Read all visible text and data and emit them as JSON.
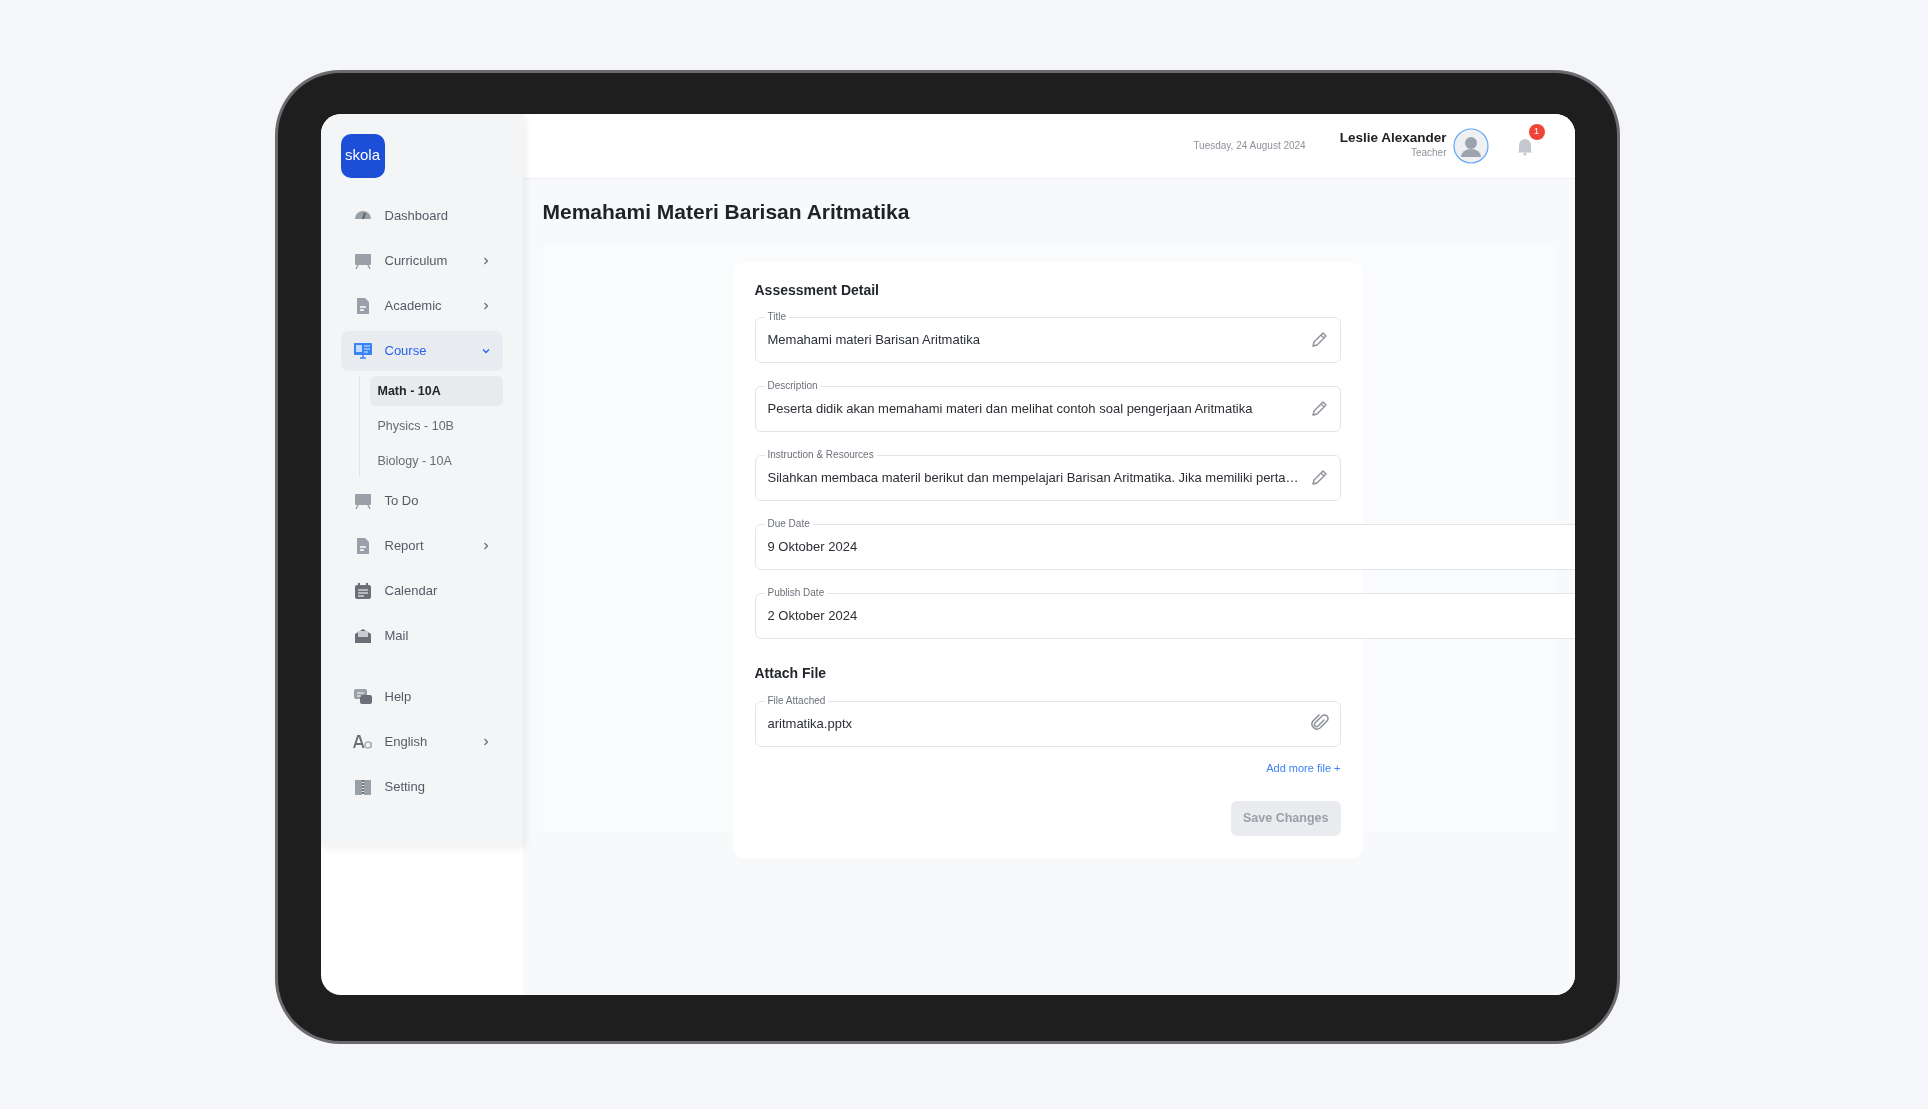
{
  "logo": {
    "text": "skola"
  },
  "sidebar": {
    "items": [
      {
        "label": "Dashboard",
        "kind": "link",
        "selected": false
      },
      {
        "label": "Curriculum",
        "kind": "menu",
        "expanded": false,
        "selected": false
      },
      {
        "label": "Academic",
        "kind": "menu",
        "expanded": false,
        "selected": false
      },
      {
        "label": "Course",
        "kind": "menu",
        "expanded": true,
        "selected": true,
        "children": [
          {
            "label": "Math - 10A",
            "selected": true
          },
          {
            "label": "Physics - 10B",
            "selected": false
          },
          {
            "label": "Biology - 10A",
            "selected": false
          }
        ]
      },
      {
        "label": "To Do",
        "kind": "link",
        "selected": false
      },
      {
        "label": "Report",
        "kind": "menu",
        "expanded": false,
        "selected": false
      },
      {
        "label": "Calendar",
        "kind": "link",
        "selected": false
      },
      {
        "label": "Mail",
        "kind": "link",
        "selected": false
      }
    ],
    "footer_items": [
      {
        "label": "Help",
        "kind": "link",
        "selected": false
      },
      {
        "label": "English",
        "kind": "menu",
        "expanded": false,
        "selected": false
      },
      {
        "label": "Setting",
        "kind": "link",
        "selected": false
      }
    ]
  },
  "header": {
    "date": "Tuesday, 24 August 2024",
    "user": {
      "name": "Leslie Alexander",
      "role": "Teacher"
    },
    "notifications": "1"
  },
  "page_title": "Memahami Materi Barisan Aritmatika",
  "sections": [
    {
      "title": "Assessment Detail",
      "fields": [
        {
          "label": "Title",
          "value": "Memahami materi Barisan Aritmatika",
          "kind": "edit"
        },
        {
          "label": "Description",
          "value": "Peserta didik akan memahami materi dan melihat contoh soal pengerjaan Aritmatika",
          "kind": "edit"
        },
        {
          "label": "Instruction & Resources",
          "value": "Silahkan membaca materil berikut dan mempelajari Barisan Aritmatika. Jika memiliki perta…",
          "kind": "edit"
        },
        {
          "label": "Due Date",
          "value": "9 Oktober 2024",
          "kind": "date"
        },
        {
          "label": "Publish Date",
          "value": "2 Oktober 2024",
          "kind": "date"
        }
      ]
    },
    {
      "title": "Attach File",
      "fields": [
        {
          "label": "File Attached",
          "value": "aritmatika.pptx",
          "kind": "file"
        }
      ],
      "link": "Add more file +"
    }
  ],
  "save_button": {
    "label": "Save Changes",
    "disabled": true
  }
}
